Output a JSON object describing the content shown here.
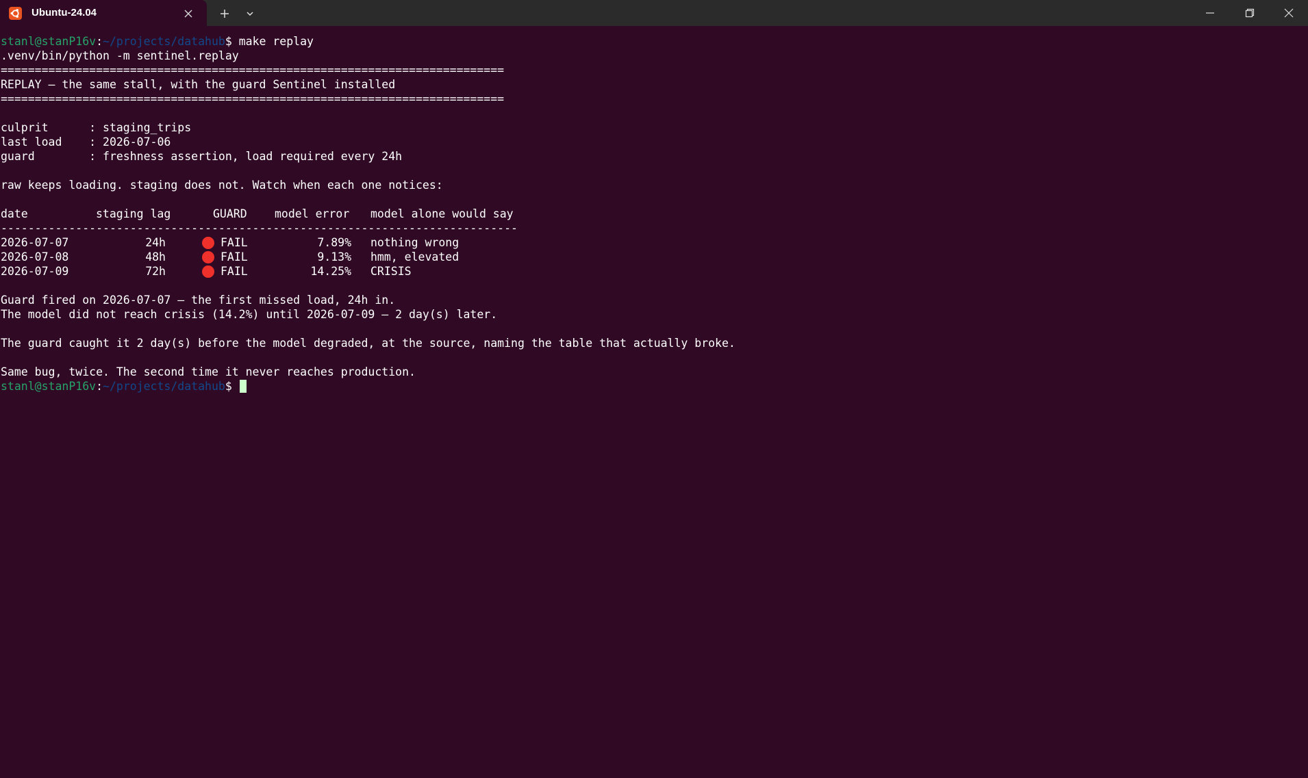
{
  "titlebar": {
    "tab_title": "Ubuntu-24.04",
    "tab_icon": "ubuntu-logo-icon",
    "buttons": {
      "close_tab": "close-icon",
      "new_tab": "plus-icon",
      "dropdown": "chevron-down-icon",
      "minimize": "minimize-icon",
      "restore": "restore-icon",
      "close_window": "close-icon"
    }
  },
  "colors": {
    "terminal_bg": "#300a24",
    "titlebar_bg": "#2b2b2b",
    "prompt_user": "#26a269",
    "prompt_path": "#12488b",
    "fail_dot": "#f0302b",
    "cursor": "#ccffcc"
  },
  "prompt": {
    "user_host": "stanl@stanP16v",
    "separator": ":",
    "path": "~/projects/datahub",
    "symbol": "$ "
  },
  "command": "make replay",
  "output": {
    "exec_line": ".venv/bin/python -m sentinel.replay",
    "rule_double": "==========================================================================",
    "heading": "REPLAY — the same stall, with the guard Sentinel installed",
    "culprit": "culprit      : staging_trips",
    "last_load": "last load    : 2026-07-06",
    "guard": "guard        : freshness assertion, load required every 24h",
    "intro": "raw keeps loading. staging does not. Watch when each one notices:",
    "table": {
      "headers": {
        "date": "date",
        "staging_lag": "staging lag",
        "guard": "GUARD",
        "model_error": "model error",
        "model_say": "model alone would say"
      },
      "rule": "----------------------------------------------------------------------------",
      "rows": [
        {
          "date": "2026-07-07",
          "lag": "24h",
          "status": "FAIL",
          "error": "7.89%",
          "say": "nothing wrong"
        },
        {
          "date": "2026-07-08",
          "lag": "48h",
          "status": "FAIL",
          "error": "9.13%",
          "say": "hmm, elevated"
        },
        {
          "date": "2026-07-09",
          "lag": "72h",
          "status": "FAIL",
          "error": "14.25%",
          "say": "CRISIS"
        }
      ]
    },
    "summary_1": "Guard fired on 2026-07-07 — the first missed load, 24h in.",
    "summary_2": "The model did not reach crisis (14.2%) until 2026-07-09 — 2 day(s) later.",
    "summary_3": "The guard caught it 2 day(s) before the model degraded, at the source, naming the table that actually broke.",
    "summary_4": "Same bug, twice. The second time it never reaches production."
  }
}
